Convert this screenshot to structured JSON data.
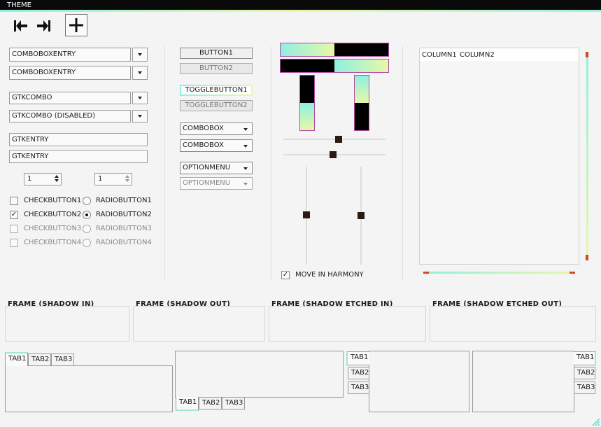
{
  "window": {
    "title": "THEME",
    "accent": "#8ff0e0",
    "accent2": "#e8f7a8"
  },
  "toolbar": {
    "items": [
      {
        "name": "goto-first-icon"
      },
      {
        "name": "goto-last-icon"
      },
      {
        "name": "add-icon"
      }
    ]
  },
  "combos_entry": [
    "COMBOBOXENTRY",
    "COMBOBOXENTRY"
  ],
  "gtk_combos": [
    "GTKCOMBO",
    "GTKCOMBO (DISABLED)"
  ],
  "entries": [
    "GTKENTRY",
    "GTKENTRY"
  ],
  "spins": [
    "1",
    "1"
  ],
  "checks": [
    {
      "label": "CHECKBUTTON1",
      "checked": false,
      "disabled": false
    },
    {
      "label": "CHECKBUTTON2",
      "checked": true,
      "disabled": false
    },
    {
      "label": "CHECKBUTTON3",
      "checked": false,
      "disabled": true
    },
    {
      "label": "CHECKBUTTON4",
      "checked": false,
      "disabled": true
    }
  ],
  "radios": [
    {
      "label": "RADIOBUTTON1",
      "selected": false,
      "disabled": false
    },
    {
      "label": "RADIOBUTTON2",
      "selected": true,
      "disabled": false
    },
    {
      "label": "RADIOBUTTON3",
      "selected": false,
      "disabled": true
    },
    {
      "label": "RADIOBUTTON4",
      "selected": false,
      "disabled": true
    }
  ],
  "buttons": {
    "button1": "BUTTON1",
    "button2": "BUTTON2",
    "toggle1": "TOGGLEBUTTON1",
    "toggle2": "TOGGLEBUTTON2"
  },
  "comboboxes": [
    "COMBOBOX",
    "COMBOBOX"
  ],
  "optionmenus": [
    "OPTIONMENU",
    "OPTIONMENU"
  ],
  "progress": {
    "h1": 0.5,
    "h2": 0.5,
    "v1": 0.5,
    "v2": 0.5
  },
  "scales": {
    "h1": 0.5,
    "h2": 0.5,
    "v1": 0.5,
    "v2": 0.5
  },
  "harmony": {
    "label": "MOVE IN HARMONY",
    "checked": true
  },
  "tree": {
    "columns": [
      "COLUMN1",
      "COLUMN2"
    ]
  },
  "frames": [
    "FRAME (SHADOW IN)",
    "FRAME (SHADOW OUT)",
    "FRAME (SHADOW ETCHED IN)",
    "FRAME (SHADOW ETCHED OUT)"
  ],
  "tabs": [
    "TAB1",
    "TAB2",
    "TAB3"
  ]
}
